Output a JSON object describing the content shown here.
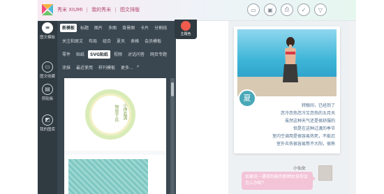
{
  "header": {
    "breadcrumbs": [
      "秀米 XIUMI",
      "我的秀米",
      "图文排版"
    ],
    "separator": "|",
    "tool_icons": [
      "folder-icon",
      "save-icon",
      "print-icon",
      "check-icon",
      "dropdown-icon"
    ]
  },
  "rail": {
    "items": [
      {
        "label": "图文模板",
        "icon": "menu-icon"
      },
      {
        "label": "图文收藏",
        "icon": "folder-icon"
      },
      {
        "label": "剪贴板",
        "icon": "clipboard-icon"
      },
      {
        "label": "我的图库",
        "icon": "image-icon"
      }
    ]
  },
  "panel": {
    "row1": [
      "新模板",
      "标题",
      "卡片",
      "图片",
      "多图",
      "背景图",
      "卡片",
      "分割线"
    ],
    "row1_selected": "新模板",
    "row2": [
      "关注和原文",
      "布局",
      "组合",
      "夏天",
      "表格",
      "会员模板"
    ],
    "row3": [
      "零件",
      "贴纸",
      "SVG贴纸",
      "视频",
      "对话问答",
      "网页专题"
    ],
    "row3_selected": "SVG贴纸",
    "row4": [
      "涂抹",
      "最近使用",
      "样刊模板",
      "更多..."
    ]
  },
  "theme_color": {
    "label": "主题色",
    "color": "#ef5b4d"
  },
  "template_cards": [
    {
      "vertical_lines": [
        "小得盈满",
        "物致于此"
      ]
    }
  ],
  "preview": {
    "season": "夏",
    "poem": [
      "转眼间，已经到了",
      "忽冷忽热忽冷又忽热的五月天",
      "虽然这种天气还是很舒服的",
      "但是在这种过渡的季节",
      "室内空调用是很容易热死，不能忍",
      "室外炎热很容易熬不大阳，很熟"
    ],
    "chat_name": "小仙女",
    "chat_message": "如果说一遇得到能的那晒女孩你会怎么办呢？"
  },
  "colors": {
    "rail_bg": "#2f3a41",
    "panel_bg": "#3a4650",
    "accent_pink": "#b3456e",
    "bubble": "#f3c3d6",
    "season_badge": "#48a8b8"
  }
}
